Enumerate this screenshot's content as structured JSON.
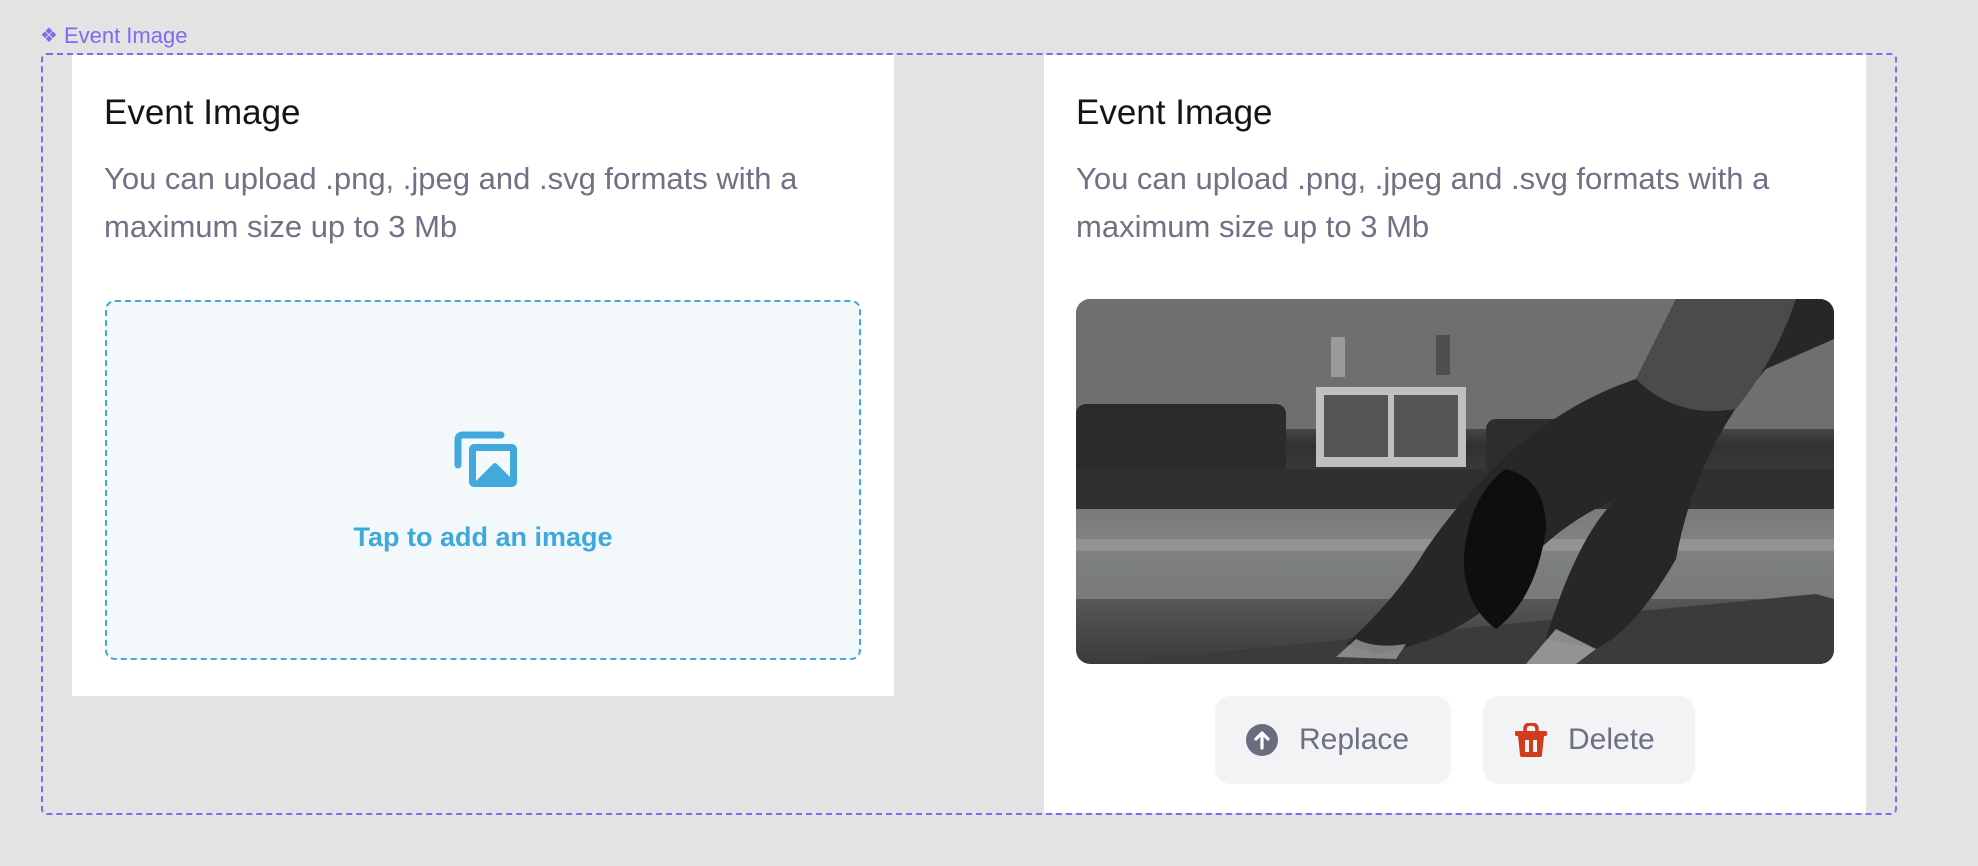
{
  "frame": {
    "label": "Event Image",
    "label_icon": "component-diamond-icon",
    "accent_color": "#7b6cf0"
  },
  "cards": [
    {
      "state": "empty",
      "title": "Event Image",
      "description": "You can upload .png, .jpeg and .svg formats with a maximum size up to 3 Mb",
      "dropzone": {
        "icon": "image-gallery-icon",
        "label": "Tap to add an image",
        "accent_color": "#3fa8dc"
      }
    },
    {
      "state": "uploaded",
      "title": "Event Image",
      "description": "You can upload .png, .jpeg and .svg formats with a maximum size up to 3 Mb",
      "image": {
        "alt": "Black and white photo of a woman in downward dog yoga pose on a mat"
      },
      "actions": [
        {
          "label": "Replace",
          "icon": "upload-circle-icon",
          "icon_color": "#6b6c7e"
        },
        {
          "label": "Delete",
          "icon": "trash-icon",
          "icon_color": "#d13b1e"
        }
      ]
    }
  ]
}
